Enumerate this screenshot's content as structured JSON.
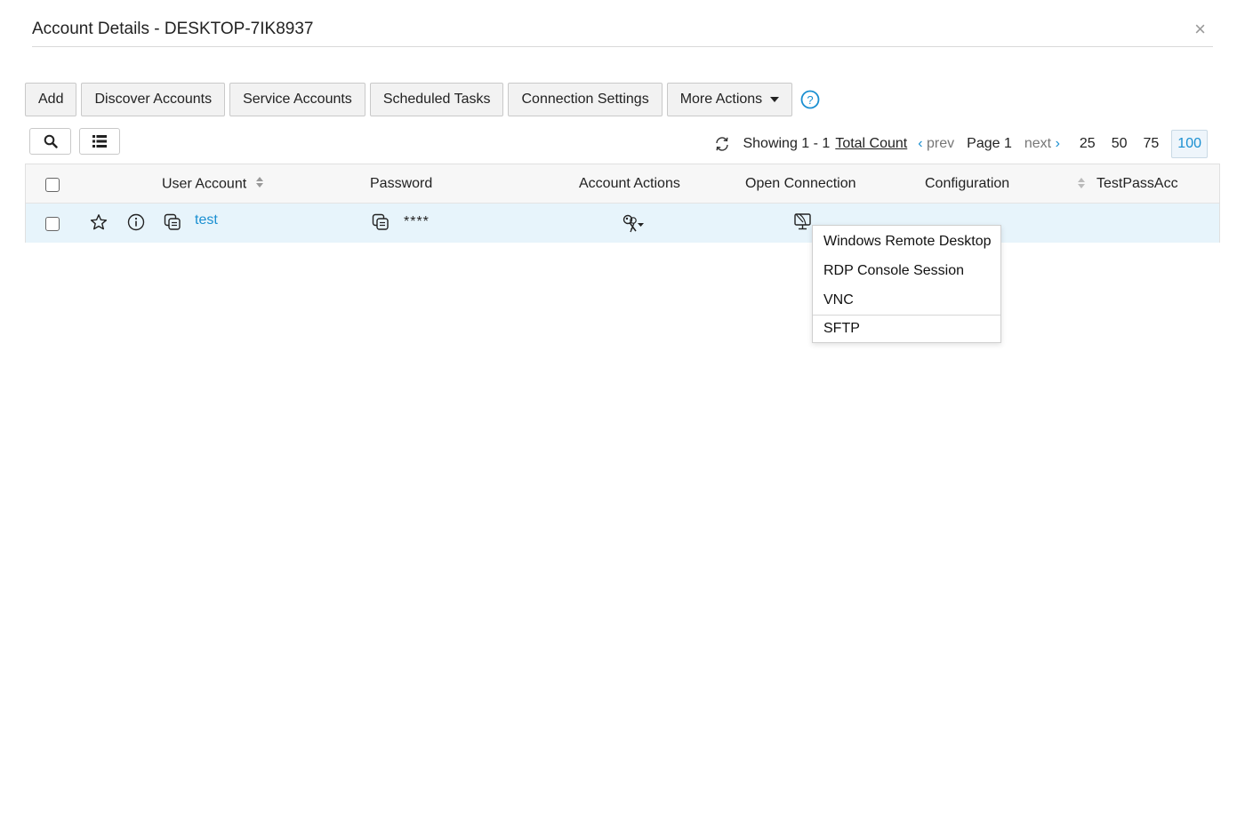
{
  "dialog": {
    "title": "Account Details - DESKTOP-7IK8937",
    "close_label": "×"
  },
  "toolbar": {
    "buttons": [
      {
        "label": "Add"
      },
      {
        "label": "Discover Accounts"
      },
      {
        "label": "Service Accounts"
      },
      {
        "label": "Scheduled Tasks"
      },
      {
        "label": "Connection Settings"
      },
      {
        "label": "More Actions"
      }
    ],
    "help_icon": "question-circle-icon"
  },
  "pager": {
    "showing": "Showing 1 - 1",
    "total_count": "Total Count",
    "prev": "prev",
    "page": "Page 1",
    "next": "next",
    "sizes": [
      "25",
      "50",
      "75",
      "100"
    ],
    "active_size": "100"
  },
  "table": {
    "columns": [
      "User Account",
      "Password",
      "Account Actions",
      "Open Connection",
      "Configuration",
      "TestPassAcc"
    ],
    "rows": [
      {
        "user_account": "test",
        "password": "****"
      }
    ]
  },
  "connection_menu": {
    "items": [
      "Windows Remote Desktop",
      "RDP Console Session",
      "VNC",
      "SFTP"
    ]
  },
  "colors": {
    "accent": "#1a8fd1",
    "row_highlight": "#e7f4fb",
    "header_bg": "#f7f7f7",
    "button_bg": "#f2f2f2"
  }
}
